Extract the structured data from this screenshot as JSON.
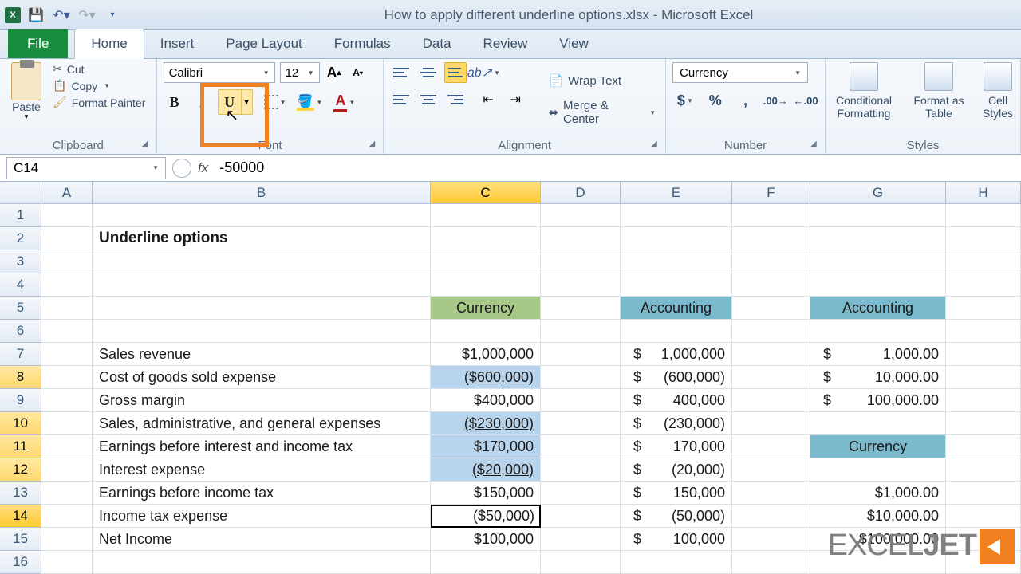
{
  "title": "How to apply different underline options.xlsx - Microsoft Excel",
  "tabs": {
    "file": "File",
    "home": "Home",
    "insert": "Insert",
    "pageLayout": "Page Layout",
    "formulas": "Formulas",
    "data": "Data",
    "review": "Review",
    "view": "View"
  },
  "ribbon": {
    "clipboard": {
      "label": "Clipboard",
      "paste": "Paste",
      "cut": "Cut",
      "copy": "Copy",
      "formatPainter": "Format Painter"
    },
    "font": {
      "label": "Font",
      "name": "Calibri",
      "size": "12"
    },
    "alignment": {
      "label": "Alignment",
      "wrapText": "Wrap Text",
      "mergeCenter": "Merge & Center"
    },
    "number": {
      "label": "Number",
      "format": "Currency"
    },
    "styles": {
      "label": "Styles",
      "conditional": "Conditional Formatting",
      "formatTable": "Format as Table",
      "cellStyles": "Cell Styles"
    }
  },
  "nameBox": "C14",
  "formula": "-50000",
  "colHeaders": [
    "A",
    "B",
    "C",
    "D",
    "E",
    "F",
    "G",
    "H"
  ],
  "sheet": {
    "title": "Underline options",
    "colC_header": "Currency",
    "colE_header": "Accounting",
    "colG_header": "Accounting",
    "colG_header2": "Currency",
    "rows": [
      {
        "label": "Sales revenue",
        "c": "$1,000,000",
        "eSym": "$",
        "eVal": "1,000,000",
        "gSym": "$",
        "gVal": "1,000.00"
      },
      {
        "label": "Cost of goods sold expense",
        "c": "($600,000)",
        "eSym": "$",
        "eVal": "(600,000)",
        "gSym": "$",
        "gVal": "10,000.00"
      },
      {
        "label": "Gross margin",
        "c": "$400,000",
        "eSym": "$",
        "eVal": "400,000",
        "gSym": "$",
        "gVal": "100,000.00"
      },
      {
        "label": "Sales, administrative, and general expenses",
        "c": "($230,000)",
        "eSym": "$",
        "eVal": "(230,000)",
        "gSym": "",
        "gVal": ""
      },
      {
        "label": "Earnings before interest and income tax",
        "c": "$170,000",
        "eSym": "$",
        "eVal": "170,000",
        "gSym": "",
        "gVal": ""
      },
      {
        "label": "Interest expense",
        "c": "($20,000)",
        "eSym": "$",
        "eVal": "(20,000)",
        "gSym": "",
        "gVal": ""
      },
      {
        "label": "Earnings before income tax",
        "c": "$150,000",
        "eSym": "$",
        "eVal": "150,000",
        "gSym": "",
        "gVal": "$1,000.00"
      },
      {
        "label": "Income tax expense",
        "c": "($50,000)",
        "eSym": "$",
        "eVal": "(50,000)",
        "gSym": "",
        "gVal": "$10,000.00"
      },
      {
        "label": "Net Income",
        "c": "$100,000",
        "eSym": "$",
        "eVal": "100,000",
        "gSym": "",
        "gVal": "$100,000.00"
      }
    ]
  },
  "watermark": {
    "a": "EXCEL",
    "b": "JET"
  },
  "chart_data": null
}
